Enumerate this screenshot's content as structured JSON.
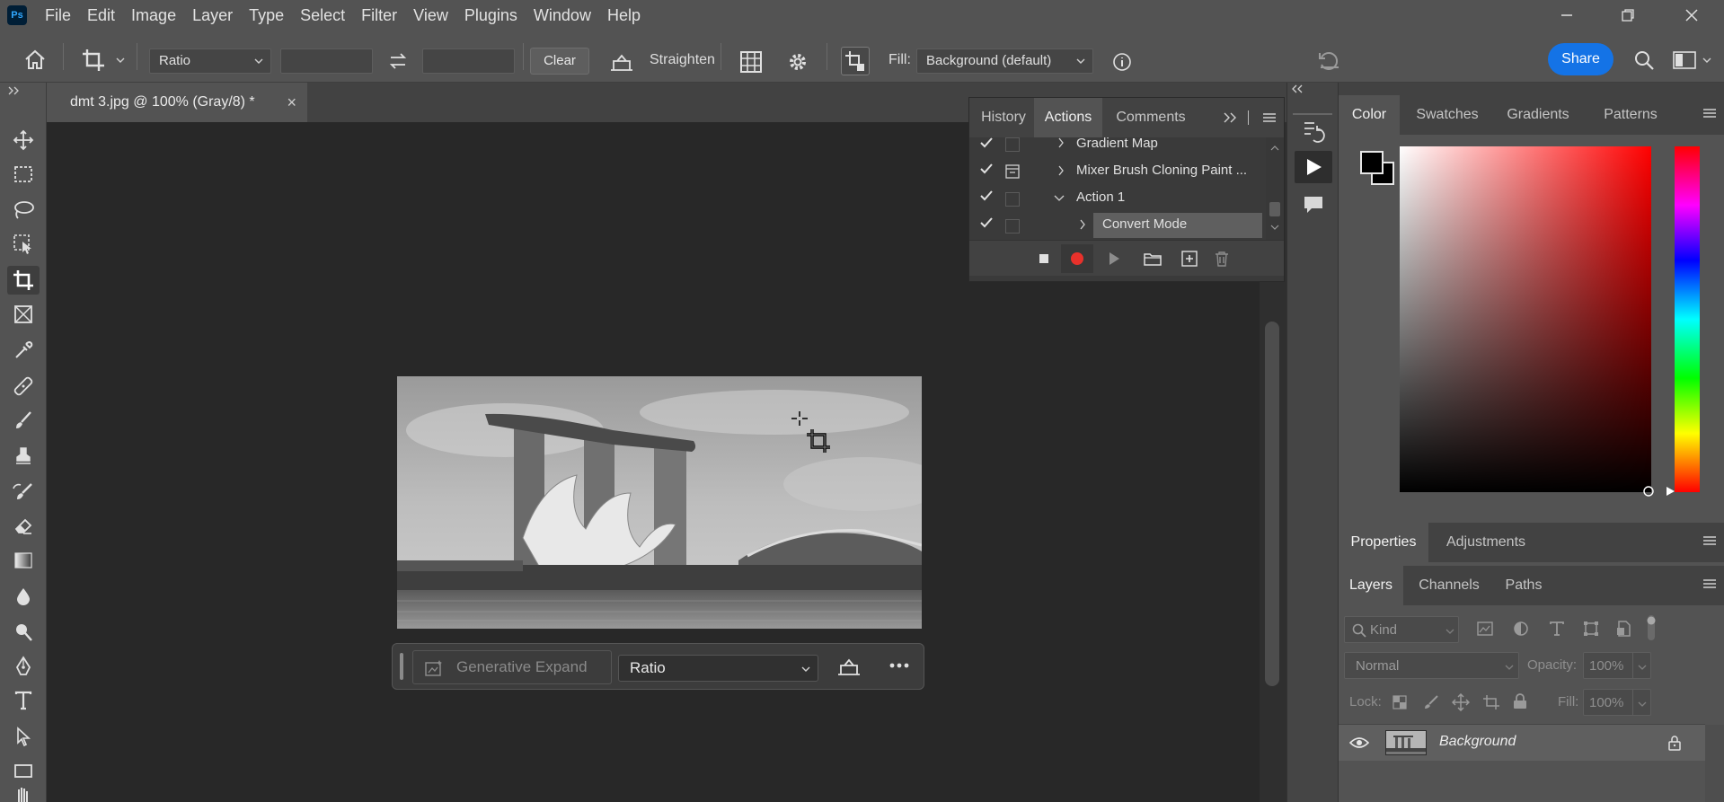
{
  "app": {
    "logo": "Ps"
  },
  "menu": [
    "File",
    "Edit",
    "Image",
    "Layer",
    "Type",
    "Select",
    "Filter",
    "View",
    "Plugins",
    "Window",
    "Help"
  ],
  "options": {
    "ratio_select": "Ratio",
    "width_value": "",
    "height_value": "",
    "clear_label": "Clear",
    "straighten_label": "Straighten",
    "fill_label": "Fill:",
    "fill_value": "Background (default)",
    "share_label": "Share"
  },
  "document": {
    "tab_title": "dmt 3.jpg @ 100% (Gray/8) *",
    "close_glyph": "×"
  },
  "contextual_bar": {
    "generative_expand_label": "Generative Expand",
    "ratio_select": "Ratio"
  },
  "actions_panel": {
    "tabs": [
      "History",
      "Actions",
      "Comments"
    ],
    "active_tab": "Actions",
    "rows": [
      {
        "label": "Gradient Map"
      },
      {
        "label": "Mixer Brush Cloning Paint ..."
      },
      {
        "label": "Action 1"
      },
      {
        "label": "Convert Mode"
      }
    ]
  },
  "color_panel": {
    "tabs": [
      "Color",
      "Swatches",
      "Gradients",
      "Patterns"
    ],
    "active_tab": "Color",
    "foreground": "#000000",
    "background": "#000000",
    "hue_color": "#ff0000"
  },
  "properties_panel": {
    "tabs": [
      "Properties",
      "Adjustments"
    ],
    "active_tab": "Properties"
  },
  "layers_panel": {
    "tabs": [
      "Layers",
      "Channels",
      "Paths"
    ],
    "active_tab": "Layers",
    "filter_placeholder": "Kind",
    "blend_mode": "Normal",
    "opacity_label": "Opacity:",
    "opacity_value": "100%",
    "lock_label": "Lock:",
    "fill_label": "Fill:",
    "fill_value": "100%",
    "layers": [
      {
        "name": "Background",
        "visible": true,
        "locked": true
      }
    ]
  },
  "colors": {
    "accent": "#1473e6",
    "record": "#e8312b",
    "panel": "#535353",
    "canvas": "#282828"
  }
}
